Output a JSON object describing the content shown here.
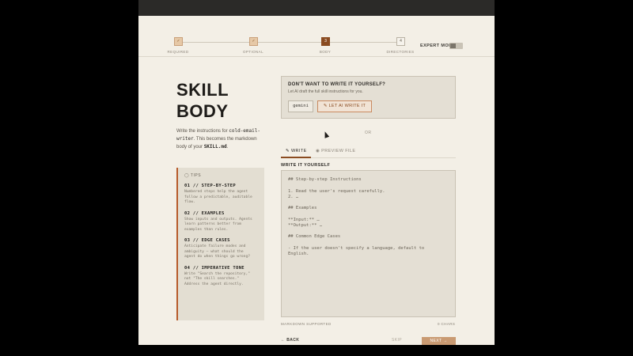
{
  "stepper": {
    "steps": [
      {
        "label": "REQUIRED",
        "marker": "✓"
      },
      {
        "label": "OPTIONAL",
        "marker": "✓"
      },
      {
        "label": "BODY",
        "marker": "3"
      },
      {
        "label": "DIRECTORIES",
        "marker": "4"
      }
    ],
    "expert_mode_label": "EXPERT MODE"
  },
  "left": {
    "title_line1": "SKILL",
    "title_line2": "BODY",
    "desc_pre": "Write the instructions for ",
    "desc_skill": "cold-email-writer",
    "desc_mid": ". This becomes the markdown body of your ",
    "desc_file": "SKILL.md",
    "desc_end": "."
  },
  "tips": {
    "heading": "TIPS",
    "items": [
      {
        "title": "01 // STEP-BY-STEP",
        "body": "Numbered steps help the agent follow a predictable, auditable flow."
      },
      {
        "title": "02 // EXAMPLES",
        "body": "Show inputs and outputs. Agents learn patterns better from examples than rules."
      },
      {
        "title": "03 // EDGE CASES",
        "body": "Anticipate failure modes and ambiguity — what should the agent do when things go wrong?"
      },
      {
        "title": "04 // IMPERATIVE TONE",
        "body": "Write \"Search the repository,\" not \"The skill searches.\" Address the agent directly."
      }
    ]
  },
  "ai_box": {
    "title": "DON'T WANT TO WRITE IT YOURSELF?",
    "subtitle": "Let AI draft the full skill instructions for you.",
    "gemini_label": "gemini",
    "ai_button_label": "LET AI WRITE IT"
  },
  "divider_or": "OR",
  "tabs": {
    "write": "WRITE",
    "preview": "PREVIEW FILE"
  },
  "editor": {
    "label": "WRITE IT YOURSELF",
    "lines": [
      "## Step-by-step Instructions",
      "",
      "1. Read the user's request carefully.",
      "2. …",
      "",
      "## Examples",
      "",
      "**Input:** …",
      "**Output:** …",
      "",
      "## Common Edge Cases",
      "",
      "- If the user doesn't specify a language, default to",
      "English."
    ],
    "markdown_note": "MARKDOWN SUPPORTED",
    "char_count": "0 CHARS"
  },
  "footer": {
    "back": "← BACK",
    "skip": "SKIP",
    "next": "NEXT →"
  }
}
